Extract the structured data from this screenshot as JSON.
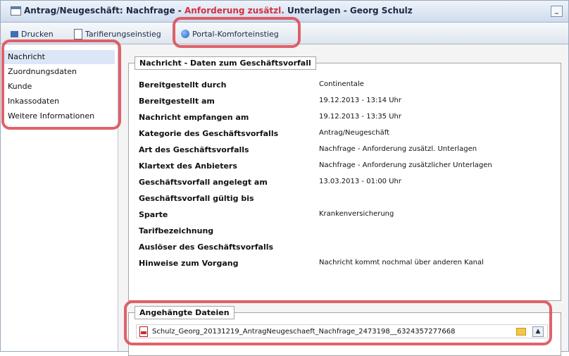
{
  "window": {
    "title_prefix": "Antrag/Neugeschäft: Nachfrage - ",
    "title_highlight": "Anforderung zusätzl.",
    "title_suffix": " Unterlagen - Georg Schulz",
    "minimize_glyph": "_"
  },
  "toolbar": {
    "print_label": "Drucken",
    "tariff_label": "Tarifierungseinstieg",
    "portal_label": "Portal-Komforteinstieg"
  },
  "sidebar": {
    "items": [
      {
        "label": "Nachricht"
      },
      {
        "label": "Zuordnungsdaten"
      },
      {
        "label": "Kunde"
      },
      {
        "label": "Inkassodaten"
      },
      {
        "label": "Weitere Informationen"
      }
    ]
  },
  "message_panel": {
    "legend": "Nachricht - Daten zum Geschäftsvorfall",
    "rows": [
      {
        "label": "Bereitgestellt durch",
        "value": "Continentale"
      },
      {
        "label": "Bereitgestellt am",
        "value": "19.12.2013 - 13:14 Uhr"
      },
      {
        "label": "Nachricht empfangen am",
        "value": "19.12.2013 - 13:35 Uhr"
      },
      {
        "label": "Kategorie des Geschäftsvorfalls",
        "value": "Antrag/Neugeschäft"
      },
      {
        "label": "Art des Geschäftsvorfalls",
        "value": "Nachfrage - Anforderung zusätzl. Unterlagen"
      },
      {
        "label": "Klartext des Anbieters",
        "value": "Nachfrage - Anforderung zusätzlicher Unterlagen"
      },
      {
        "label": "Geschäftsvorfall angelegt am",
        "value": "13.03.2013 - 01:00 Uhr"
      },
      {
        "label": "Geschäftsvorfall gültig bis",
        "value": ""
      },
      {
        "label": "Sparte",
        "value": "Krankenversicherung"
      },
      {
        "label": "Tarifbezeichnung",
        "value": ""
      },
      {
        "label": "Auslöser des Geschäftsvorfalls",
        "value": ""
      },
      {
        "label": "Hinweise zum Vorgang",
        "value": "Nachricht kommt nochmal über anderen Kanal"
      }
    ]
  },
  "attachments_panel": {
    "legend": "Angehängte Dateien",
    "files": [
      {
        "name": "Schulz_Georg_20131219_AntragNeugeschaeft_Nachfrage_2473198__6324357277668"
      }
    ],
    "scroll_glyph": "▲"
  }
}
